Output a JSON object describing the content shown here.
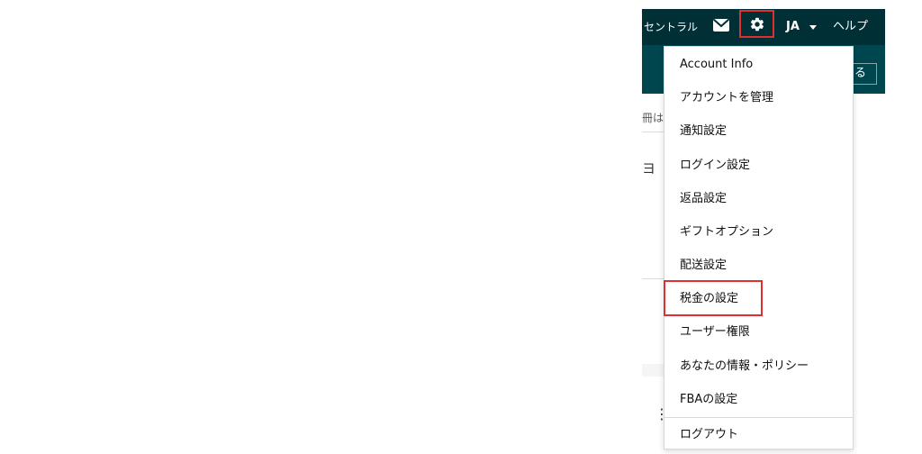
{
  "topbar": {
    "central_text": "セントラル",
    "language": "JA",
    "help": "ヘルプ"
  },
  "subbar": {
    "button_fragment": "る"
  },
  "page": {
    "crumb_fragment": "冊は",
    "icon_fragment": "ヨ"
  },
  "menu": {
    "items": [
      {
        "label": "Account Info"
      },
      {
        "label": "アカウントを管理"
      },
      {
        "label": "通知設定"
      },
      {
        "label": "ログイン設定"
      },
      {
        "label": "返品設定"
      },
      {
        "label": "ギフトオプション"
      },
      {
        "label": "配送設定"
      },
      {
        "label": "税金の設定"
      },
      {
        "label": "ユーザー権限"
      },
      {
        "label": "あなたの情報・ポリシー"
      },
      {
        "label": "FBAの設定"
      },
      {
        "label": "ログアウト"
      }
    ],
    "highlighted": "税金の設定"
  },
  "colors": {
    "topbar": "#002f36",
    "subbar": "#00464f",
    "highlight_border": "#e02f2f"
  },
  "icons": [
    "mail-icon",
    "gear-icon",
    "caret-down-icon",
    "kebab-icon"
  ]
}
